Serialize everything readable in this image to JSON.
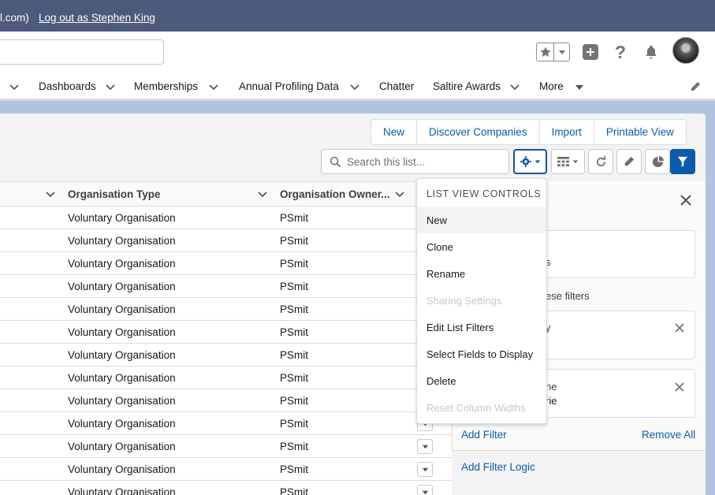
{
  "banner": {
    "email_fragment": "l.com)",
    "logout_link": "Log out as Stephen King"
  },
  "nav": {
    "items": [
      "Dashboards",
      "Memberships",
      "Annual Profiling Data",
      "Chatter",
      "Saltire Awards",
      "More"
    ]
  },
  "actions": {
    "buttons": [
      "New",
      "Discover Companies",
      "Import",
      "Printable View"
    ]
  },
  "list_search": {
    "placeholder": "Search this list..."
  },
  "table": {
    "columns": [
      "Organisation Type",
      "Organisation Owner..."
    ],
    "rows": [
      [
        "Voluntary Organisation",
        "PSmit"
      ],
      [
        "Voluntary Organisation",
        "PSmit"
      ],
      [
        "Voluntary Organisation",
        "PSmit"
      ],
      [
        "Voluntary Organisation",
        "PSmit"
      ],
      [
        "Voluntary Organisation",
        "PSmit"
      ],
      [
        "Voluntary Organisation",
        "PSmit"
      ],
      [
        "Voluntary Organisation",
        "PSmit"
      ],
      [
        "Voluntary Organisation",
        "PSmit"
      ],
      [
        "Voluntary Organisation",
        "PSmit"
      ],
      [
        "Voluntary Organisation",
        "PSmit"
      ],
      [
        "Voluntary Organisation",
        "PSmit"
      ],
      [
        "Voluntary Organisation",
        "PSmit"
      ],
      [
        "Voluntary Organisation",
        "PSmit"
      ]
    ]
  },
  "menu": {
    "heading": "LIST VIEW CONTROLS",
    "items": [
      {
        "label": "New",
        "state": "hover"
      },
      {
        "label": "Clone",
        "state": "enabled"
      },
      {
        "label": "Rename",
        "state": "enabled"
      },
      {
        "label": "Sharing Settings",
        "state": "disabled"
      },
      {
        "label": "Edit List Filters",
        "state": "enabled"
      },
      {
        "label": "Select Fields to Display",
        "state": "highlighted"
      },
      {
        "label": "Delete",
        "state": "enabled"
      },
      {
        "label": "Reset Column Widths",
        "state": "disabled"
      }
    ]
  },
  "filter_panel": {
    "partial_box1": "s",
    "partial_label": "ese filters",
    "partial_filter1": "y",
    "partial_filter2_line1": "ne",
    "partial_filter2_line2": "rie",
    "add_filter": "Add Filter",
    "remove_all": "Remove All",
    "add_filter_logic": "Add Filter Logic"
  },
  "colors": {
    "banner": "#4c5a7b",
    "brand_blue": "#0b5cab",
    "highlighter": "#f7f400"
  }
}
